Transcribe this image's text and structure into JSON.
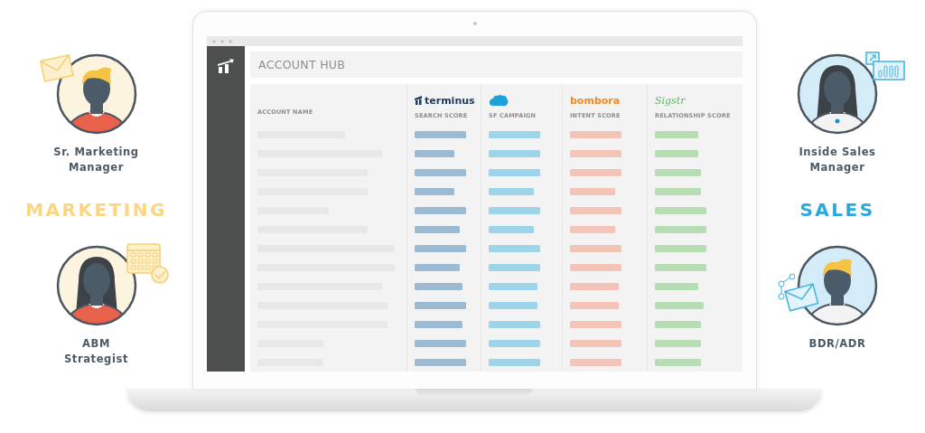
{
  "sections": [
    {
      "kind": "marketing",
      "title": "MARKETING",
      "color": "#fdd57e",
      "personas": [
        {
          "label": "Sr. Marketing\nManager",
          "kind": "envelope"
        },
        {
          "label": "ABM\nStrategist",
          "kind": "calendar"
        }
      ]
    },
    {
      "kind": "sales",
      "title": "SALES",
      "color": "#2aa8e0",
      "personas": [
        {
          "label": "Inside Sales\nManager",
          "kind": "chart"
        },
        {
          "label": "BDR/ADR",
          "kind": "mail-network"
        }
      ]
    }
  ],
  "app": {
    "title": "ACCOUNT HUB",
    "columns": [
      {
        "kind": "name",
        "label": "ACCOUNT NAME",
        "color": "#e8e8e8"
      },
      {
        "kind": "score",
        "label": "SEARCH SCORE",
        "color": "#9bbad4",
        "logo": {
          "kind": "terminus",
          "text": "terminus"
        }
      },
      {
        "kind": "score",
        "label": "SF CAMPAIGN",
        "color": "#9dd4ea",
        "logo": {
          "kind": "cloud"
        }
      },
      {
        "kind": "score",
        "label": "INTENT SCORE",
        "color": "#f5c4b8",
        "logo": {
          "kind": "bombora",
          "text": "bombora"
        }
      },
      {
        "kind": "score",
        "label": "RELATIONSHIP SCORE",
        "color": "#b6ddb4",
        "logo": {
          "kind": "sigstr",
          "text": "Sigstr"
        }
      }
    ]
  }
}
